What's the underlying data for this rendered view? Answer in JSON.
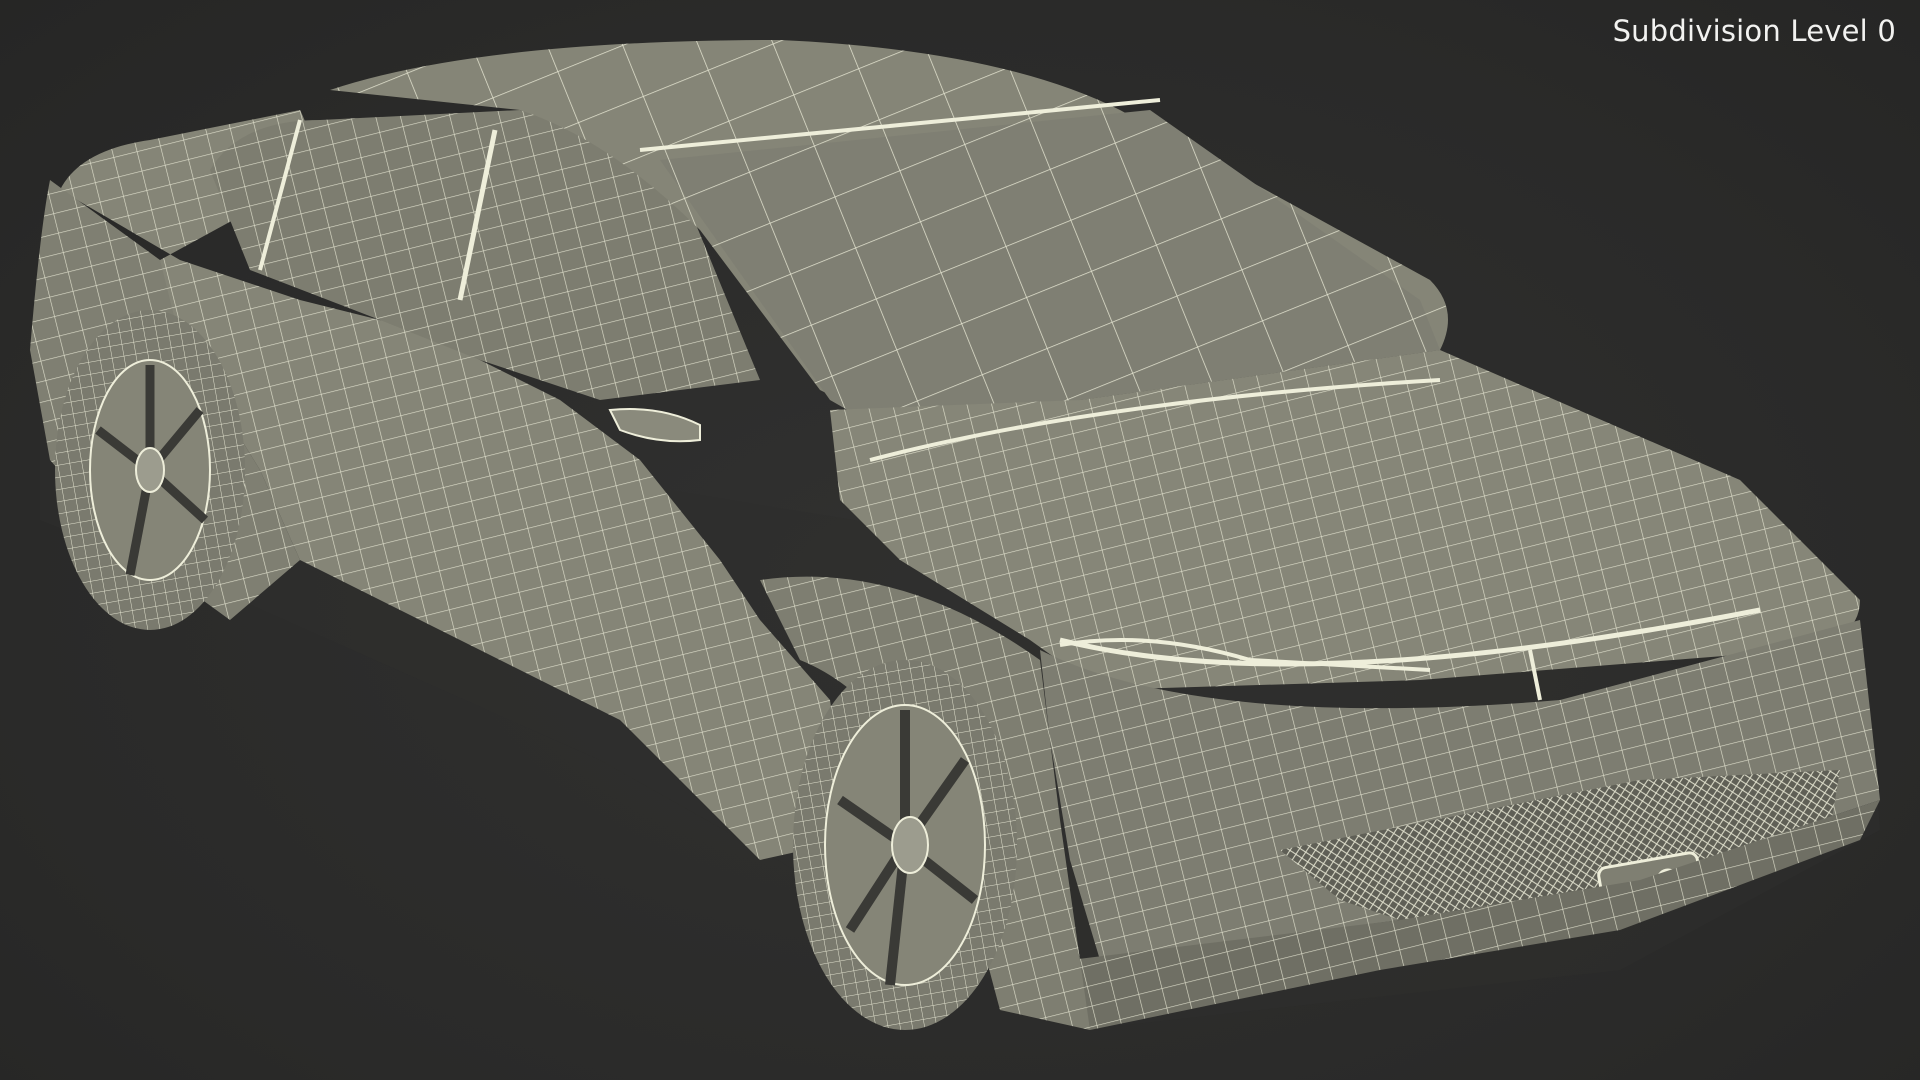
{
  "viewport": {
    "subdivision_label": "Subdivision Level 0"
  },
  "scene": {
    "subject": "car-wireframe",
    "colors": {
      "background": "#2b2b2a",
      "surface": "#858577",
      "surface_dark": "#6d6d62",
      "wire": "#eeeeda",
      "tire": "#7c7c70"
    }
  }
}
